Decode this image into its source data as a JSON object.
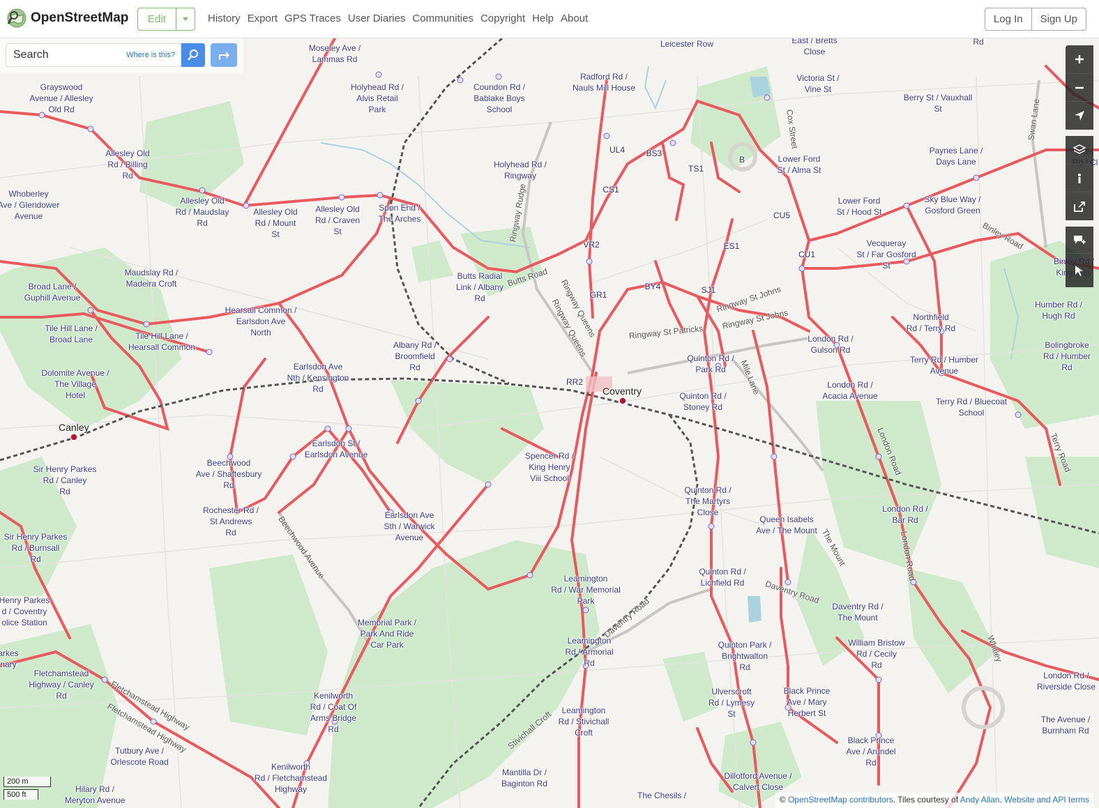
{
  "header": {
    "logo_text": "OpenStreetMap",
    "edit_label": "Edit",
    "nav": [
      "History",
      "Export",
      "GPS Traces",
      "User Diaries",
      "Communities",
      "Copyright",
      "Help",
      "About"
    ],
    "login_label": "Log In",
    "signup_label": "Sign Up"
  },
  "search": {
    "placeholder": "Search",
    "where_label": "Where is this?"
  },
  "map": {
    "stop_labels": [
      "Moseley Ave /\nLammas Rd",
      "Grayswood\nAvenue / Allesley\nOld Rd",
      "Holyhead Rd /\nAlvis Retail\nPark",
      "Coundon Rd /\nBablake Boys\nSchool",
      "Radford Rd /\nNauls Mill House",
      "Leicester Row",
      "East / Bretts\nClose",
      "Victoria St /\nVine St",
      "Berry St / Vauxhall\nSt",
      "Rd",
      "Allesley Old\nRd / Billing\nRd",
      "Holyhead Rd /\nRingway",
      "Lower Ford\nSt / Alma St",
      "Paynes Lane /\nDays Lane",
      "Whoberley\nAve / Glendower\nAvenue",
      "Allesley Old\nRd / Maudslay\nRd",
      "Allesley Old\nRd / Mount\nSt",
      "Allesley Old\nRd / Craven\nSt",
      "Spon End /\nThe Arches",
      "Lower Ford\nSt / Hood St",
      "Sky Blue Way /\nGosford Green",
      "Vecqueray\nSt / Far Gosford\nSt",
      "Binley Rd /\nKingsway",
      "Maudslay Rd /\nMadeira Croft",
      "Broad Lane /\nGuphill Avenue",
      "Butts Radial\nLink / Albany\nRd",
      "Humber Rd /\nHugh Rd",
      "Hearsall Common /\nEarlsdon Ave\nNorth",
      "Northfield\nRd / Terry Rd",
      "Tile Hill Lane /\nBroad Lane",
      "Tile Hill Lane /\nHearsall Common",
      "London Rd /\nGulson Rd",
      "Albany Rd /\nBroomfield\nRd",
      "Bolingbroke\nRd / Humber\nRd",
      "Terry Rd / Humber\nAvenue",
      "Quinton Rd /\nPark Rd",
      "Dolomite Avenue /\nThe Village\nHotel",
      "Earlsdon Ave\nNth / Kensington\nRd",
      "London Rd /\nAcacia Avenue",
      "Quinton Rd /\nStoney Rd",
      "Terry Rd / Bluecoat\nSchool",
      "Earlsdon St /\nEarlsdon Avenue",
      "Spencer Rd /\nKing Henry\nViii School",
      "Sir Henry Parkes\nRd / Canley\nRd",
      "Beechwood\nAve / Shaftesbury\nRd",
      "Quinton Rd /\nThe Martyrs\nClose",
      "London Rd /\nBar Rd",
      "Rochester Rd /\nSt Andrews\nRd",
      "Earlsdon Ave\nSth / Warwick\nAvenue",
      "Queen Isabels\nAve / The Mount",
      "Sir Henry Parkes\nRd / Burnsall\nRd",
      "Leamington\nRd / War Memorial\nPark",
      "Quinton Rd /\nLichfield Rd",
      "Henry Parkes\nd / Coventry\nolice Station",
      "Daventry Rd /\nThe Mount",
      "Memorial Park /\nPark And Ride\nCar Park",
      "Leamington\nRd / Armorial\nRd",
      "William Bristow\nRd / Cecily\nRd",
      "Quinton Park /\nBrightwalton\nRd",
      "arkes\nnary",
      "Fletchamstead\nHighway / Canley\nRd",
      "London Rd /\nRiverside Close",
      "Kenilworth\nRd / Coat Of\nArms Bridge\nRd",
      "Ulverscroft\nRd / Lymesy\nSt",
      "Black Prince\nAve / Mary\nHerbert St",
      "Leamington\nRd / Stivichall\nCroft",
      "The Avenue /\nBurnham Rd",
      "Tutbury Ave /\nOrlescote Road",
      "Black Prince\nAve / Arundel\nRd",
      "Kenilworth\nRd / Fletchamstead\nHighway",
      "Dillotford Avenue /\nCalvert Close",
      "Mantilla Dr /\nBaginton Rd",
      "Hilary Rd /\nMeryton Avenue",
      "The Chesils /"
    ],
    "route_codes": [
      "UL4",
      "BS3",
      "TS1",
      "B",
      "CS1",
      "CU5",
      "VR2",
      "ES1",
      "CU1",
      "GR1",
      "BY4",
      "SJ1",
      "RR2"
    ],
    "street_labels": [
      "Ringway Rudge",
      "Cox Street",
      "Swan Lane",
      "Binley Road",
      "Butts Road",
      "Ringway Queens",
      "Ringway Queens",
      "Ringway St Johns",
      "Ringway St Johns",
      "Ringway St Patricks",
      "Mile Lane",
      "London Road",
      "Terry Road",
      "Beechwood Avenue",
      "The Mount",
      "London Road",
      "Daventry Road",
      "Daventry Road",
      "Whitley",
      "Stivichall Croft",
      "Fletchamstead Highway",
      "Fletchamstead Highway"
    ],
    "stations": [
      "Coventry",
      "Canley"
    ],
    "right_edge_labels": [
      "Gals\nRd / Cl"
    ],
    "colors": {
      "bus_route": "#e85a5e",
      "park": "#c8e8c6",
      "rail": "#666666",
      "label": "#3c3c8a"
    }
  },
  "scale": {
    "metric": "200 m",
    "imperial": "500 ft"
  },
  "attribution": {
    "prefix": "©",
    "osm_link": "OpenStreetMap contributors",
    "middle": ". Tiles courtesy of ",
    "tiles_link": "Andy Allan",
    "sep": ". ",
    "terms_link": "Website and API terms"
  },
  "controls": {
    "zoom_in": "zoom-in-icon",
    "zoom_out": "zoom-out-icon",
    "locate": "locate-icon",
    "layers": "layers-icon",
    "info": "info-icon",
    "share": "share-icon",
    "note": "note-icon",
    "query": "query-icon"
  }
}
